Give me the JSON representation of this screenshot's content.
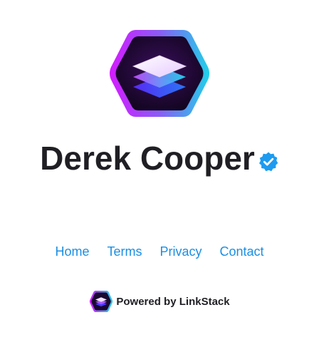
{
  "profile": {
    "name": "Derek Cooper",
    "avatar_icon": "linkstack-hexagon-logo",
    "verified_icon": "verified-badge-icon"
  },
  "nav": {
    "items": [
      {
        "label": "Home"
      },
      {
        "label": "Terms"
      },
      {
        "label": "Privacy"
      },
      {
        "label": "Contact"
      }
    ]
  },
  "footer": {
    "powered_by": "Powered by LinkStack",
    "logo_icon": "linkstack-logo-icon"
  },
  "colors": {
    "link": "#1a8fe3",
    "text": "#1f1f24",
    "verified": "#1d9bf0",
    "gradient_start": "#d41bff",
    "gradient_end": "#1fd1e8"
  }
}
